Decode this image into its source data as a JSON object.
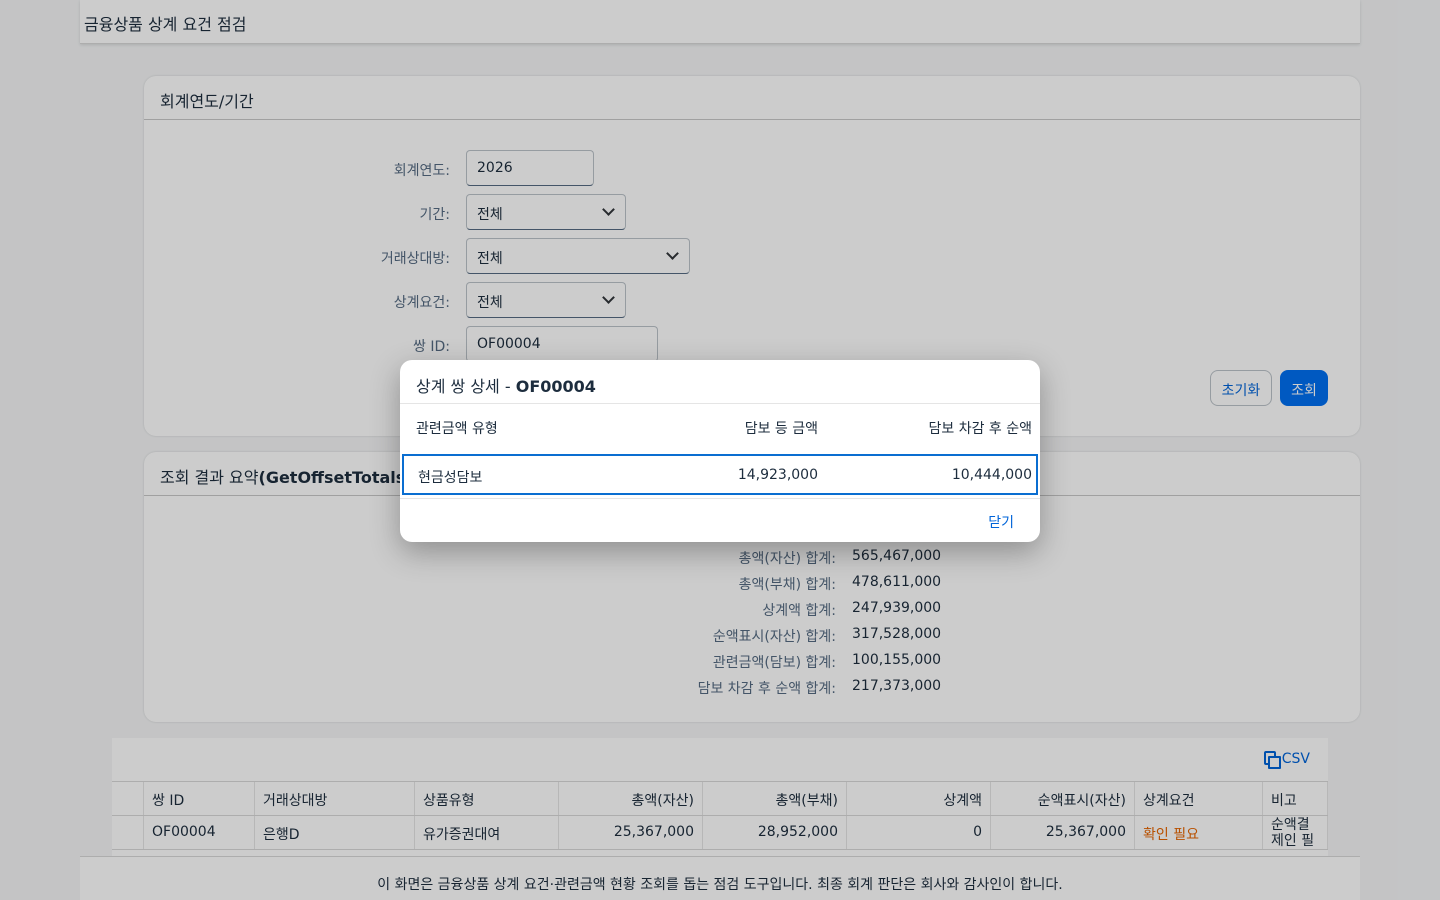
{
  "app": {
    "title": "금융상품 상계 요건 점검"
  },
  "filters": {
    "section_title": "회계연도/기간",
    "fiscal_year": {
      "label": "회계연도:",
      "value": "2026"
    },
    "period": {
      "label": "기간:",
      "value": "전체"
    },
    "counterparty": {
      "label": "거래상대방:",
      "value": "전체"
    },
    "offset_condition": {
      "label": "상계요건:",
      "value": "전체"
    },
    "pair_id": {
      "label": "쌍 ID:",
      "value": "OF00004"
    },
    "reset_label": "초기화",
    "search_label": "조회"
  },
  "summary": {
    "title_prefix": "조회 결과 요약",
    "title_suffix": "(GetOffsetTotals)",
    "rows": [
      {
        "label": "총액(자산) 합계:",
        "value": "565,467,000"
      },
      {
        "label": "총액(부채) 합계:",
        "value": "478,611,000"
      },
      {
        "label": "상계액 합계:",
        "value": "247,939,000"
      },
      {
        "label": "순액표시(자산) 합계:",
        "value": "317,528,000"
      },
      {
        "label": "관련금액(담보) 합계:",
        "value": "100,155,000"
      },
      {
        "label": "담보 차감 후 순액 합계:",
        "value": "217,373,000"
      }
    ]
  },
  "table": {
    "csv_label": "CSV",
    "headers": [
      "쌍 ID",
      "거래상대방",
      "상품유형",
      "총액(자산)",
      "총액(부채)",
      "상계액",
      "순액표시(자산)",
      "상계요건",
      "비고"
    ],
    "rows": [
      [
        "OF00004",
        "은행D",
        "유가증권대여",
        "25,367,000",
        "28,952,000",
        "0",
        "25,367,000",
        "확인 필요",
        "순액결제인 필요"
      ]
    ]
  },
  "footer": {
    "text": "이 화면은 금융상품 상계 요건·관련금액 현황 조회를 돕는 점검 도구입니다. 최종 회계 판단은 회사와 감사인이 합니다."
  },
  "dialog": {
    "title_prefix": "상계 쌍 상세 - ",
    "title_id": "OF00004",
    "headers": [
      "관련금액 유형",
      "담보 등 금액",
      "담보 차감 후 순액"
    ],
    "row": [
      "현금성담보",
      "14,923,000",
      "10,444,000"
    ],
    "close_label": "닫기"
  },
  "colors": {
    "accent": "#0070f2",
    "link": "#0064d9",
    "warning": "#e76500"
  }
}
